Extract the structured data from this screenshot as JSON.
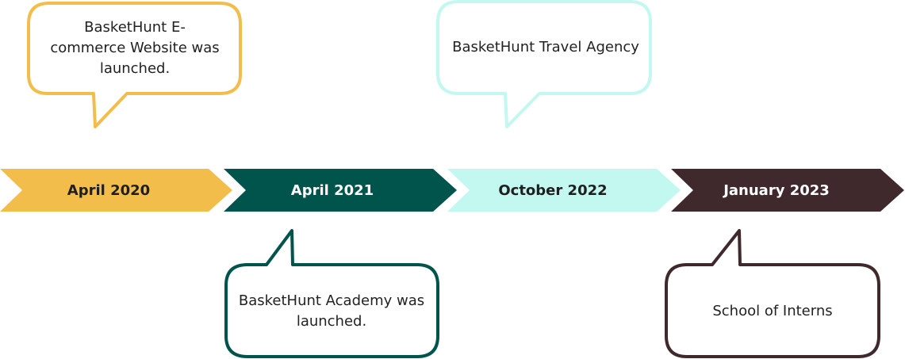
{
  "colors": {
    "yellow": "#f2bd4b",
    "green": "#00544b",
    "mint": "#c2f8f0",
    "brown": "#40292d",
    "dark_text": "#1f1f1f",
    "light_text": "#ffffff"
  },
  "timeline": [
    {
      "date": "April 2020",
      "note": "BasketHunt E-commerce Website was launched.",
      "color": "yellow"
    },
    {
      "date": "April 2021",
      "note": "BasketHunt Academy was launched.",
      "color": "green"
    },
    {
      "date": "October 2022",
      "note": "BasketHunt Travel Agency",
      "color": "mint"
    },
    {
      "date": "January 2023",
      "note": "School of Interns",
      "color": "brown"
    }
  ]
}
